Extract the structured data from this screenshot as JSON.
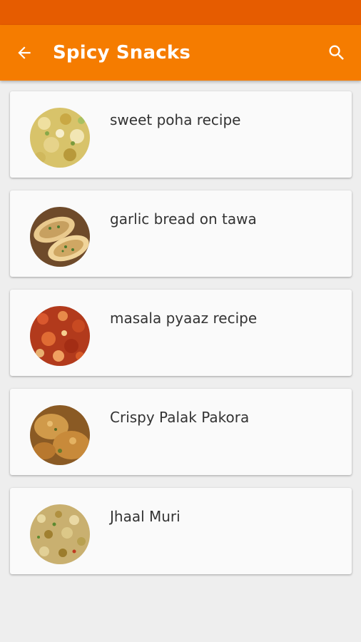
{
  "app_bar": {
    "title": "Spicy Snacks",
    "back_icon": "arrow-left-icon",
    "search_icon": "search-icon"
  },
  "colors": {
    "status_bar": "#e65c00",
    "app_bar": "#f57c00",
    "background": "#eeeeee",
    "card": "#fafafa"
  },
  "recipes": [
    {
      "label": "sweet poha recipe",
      "image": "sweet-poha-thumbnail"
    },
    {
      "label": "garlic bread on tawa",
      "image": "garlic-bread-thumbnail"
    },
    {
      "label": "masala pyaaz recipe",
      "image": "masala-pyaaz-thumbnail"
    },
    {
      "label": "Crispy Palak Pakora",
      "image": "palak-pakora-thumbnail"
    },
    {
      "label": "Jhaal Muri",
      "image": "jhaal-muri-thumbnail"
    }
  ]
}
